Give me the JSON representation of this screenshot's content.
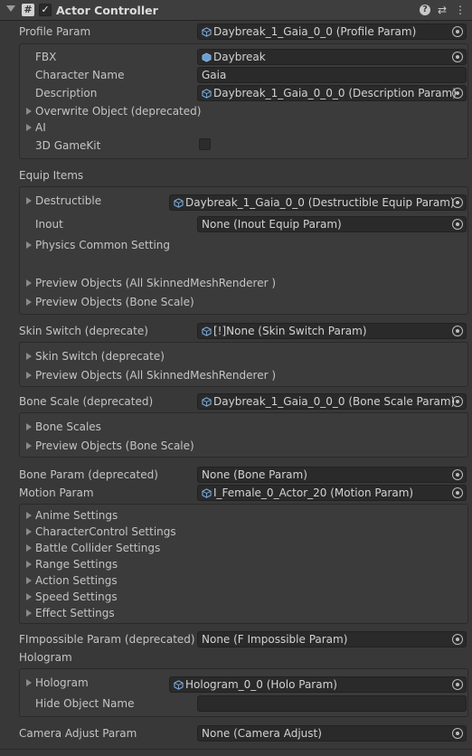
{
  "header": {
    "script_icon": "#",
    "check": "✓",
    "title": "Actor Controller"
  },
  "profile": {
    "label": "Profile Param",
    "value": "Daybreak_1_Gaia_0_0 (Profile Param)",
    "fbx_label": "FBX",
    "fbx_value": "Daybreak",
    "charname_label": "Character Name",
    "charname_value": "Gaia",
    "desc_label": "Description",
    "desc_value": "Daybreak_1_Gaia_0_0_0 (Description Param)",
    "overwrite_label": "Overwrite Object (deprecated)",
    "ai_label": "AI",
    "gamekit_label": "3D GameKit"
  },
  "equip": {
    "label": "Equip Items",
    "destructible_label": "Destructible",
    "destructible_value": "Daybreak_1_Gaia_0_0 (Destructible Equip Param)",
    "inout_label": "Inout",
    "inout_value": "None (Inout Equip Param)",
    "physics_label": "Physics Common Setting",
    "preview_smr_label": "Preview Objects (All SkinnedMeshRenderer )",
    "preview_bone_label": "Preview Objects (Bone Scale)"
  },
  "skin": {
    "label": "Skin Switch (deprecate)",
    "value": "[!]None (Skin Switch Param)",
    "inner_label": "Skin Switch (deprecate)",
    "preview_smr_label": "Preview Objects (All SkinnedMeshRenderer )"
  },
  "bonescale": {
    "label": "Bone Scale (deprecated)",
    "value": "Daybreak_1_Gaia_0_0_0 (Bone Scale Param)",
    "scales_label": "Bone Scales",
    "preview_bone_label": "Preview Objects (Bone Scale)"
  },
  "boneparam": {
    "label": "Bone Param (deprecated)",
    "value": "None (Bone Param)"
  },
  "motion": {
    "label": "Motion Param",
    "value": "I_Female_0_Actor_20 (Motion Param)",
    "items": [
      "Anime Settings",
      "CharacterControl Settings",
      "Battle Collider Settings",
      "Range Settings",
      "Action Settings",
      "Speed Settings",
      "Effect Settings"
    ]
  },
  "fimpossible": {
    "label": "FImpossible Param (deprecated)",
    "value": "None (F Impossible Param)"
  },
  "hologram": {
    "label": "Hologram",
    "inner_label": "Hologram",
    "inner_value": "Hologram_0_0 (Holo Param)",
    "hide_label": "Hide Object Name",
    "hide_value": ""
  },
  "camera": {
    "label": "Camera Adjust Param",
    "value": "None (Camera Adjust)"
  },
  "icons": {
    "help": "?",
    "settings": "⇄",
    "menu": "⋮",
    "object": "cube-icon",
    "picker": "object-picker-icon"
  }
}
